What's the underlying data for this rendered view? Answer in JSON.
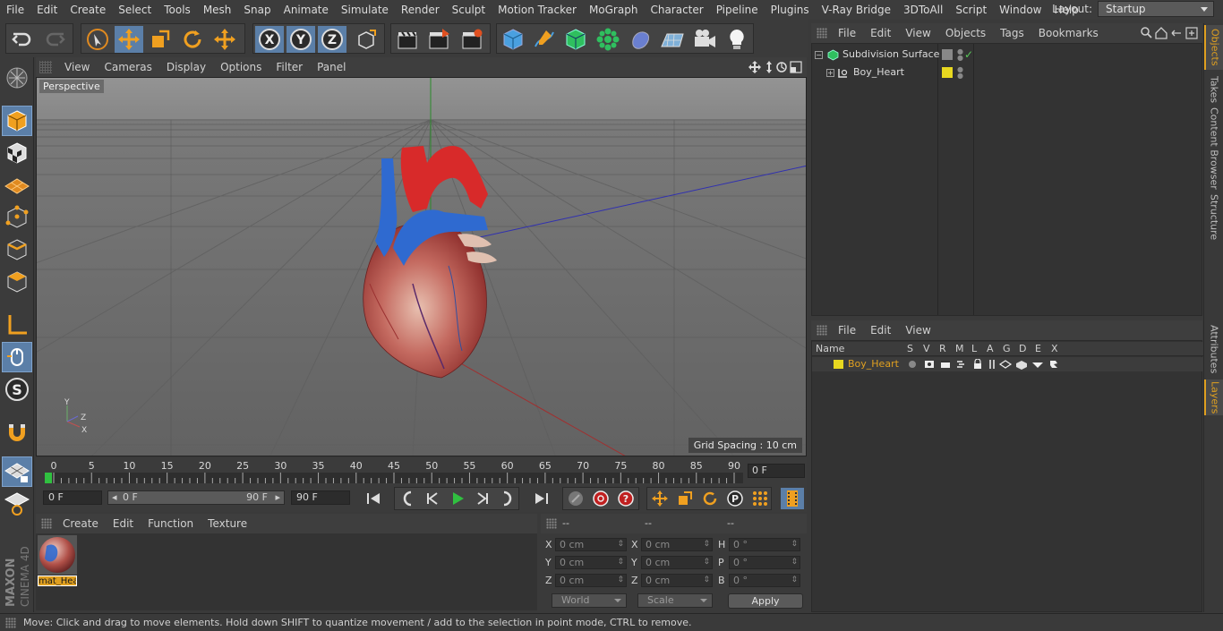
{
  "menu": {
    "items": [
      "File",
      "Edit",
      "Create",
      "Select",
      "Tools",
      "Mesh",
      "Snap",
      "Animate",
      "Simulate",
      "Render",
      "Sculpt",
      "Motion Tracker",
      "MoGraph",
      "Character",
      "Pipeline",
      "Plugins",
      "V-Ray Bridge",
      "3DToAll",
      "Script",
      "Window",
      "Help"
    ],
    "layout_label": "Layout:",
    "layout_value": "Startup"
  },
  "viewport": {
    "menu": [
      "View",
      "Cameras",
      "Display",
      "Options",
      "Filter",
      "Panel"
    ],
    "label": "Perspective",
    "grid_spacing": "Grid Spacing : 10 cm",
    "axis_x": "X",
    "axis_y": "Y",
    "axis_z": "Z"
  },
  "timeline": {
    "ticks": [
      "0",
      "5",
      "10",
      "15",
      "20",
      "25",
      "30",
      "35",
      "40",
      "45",
      "50",
      "55",
      "60",
      "65",
      "70",
      "75",
      "80",
      "85",
      "90"
    ],
    "current_frame": "0 F"
  },
  "transport": {
    "start_field": "0 F",
    "range_start": "0 F",
    "range_end": "90 F",
    "end_field": "90 F"
  },
  "material_manager": {
    "menu": [
      "Create",
      "Edit",
      "Function",
      "Texture"
    ],
    "material_name": "mat_Heart"
  },
  "coordinates": {
    "headers": [
      "--",
      "--",
      "--"
    ],
    "rows": [
      {
        "l1": "X",
        "v1": "0 cm",
        "l2": "X",
        "v2": "0 cm",
        "l3": "H",
        "v3": "0 °"
      },
      {
        "l1": "Y",
        "v1": "0 cm",
        "l2": "Y",
        "v2": "0 cm",
        "l3": "P",
        "v3": "0 °"
      },
      {
        "l1": "Z",
        "v1": "0 cm",
        "l2": "Z",
        "v2": "0 cm",
        "l3": "B",
        "v3": "0 °"
      }
    ],
    "mode_world": "World",
    "mode_scale": "Scale",
    "apply_label": "Apply"
  },
  "status": "Move: Click and drag to move elements. Hold down SHIFT to quantize movement / add to the selection in point mode, CTRL to remove.",
  "object_manager": {
    "menu": [
      "File",
      "Edit",
      "View",
      "Objects",
      "Tags",
      "Bookmarks"
    ],
    "objects": [
      {
        "name": "Subdivision Surface"
      },
      {
        "name": "Boy_Heart"
      }
    ]
  },
  "layer_manager": {
    "menu": [
      "File",
      "Edit",
      "View"
    ],
    "columns": [
      "Name",
      "S",
      "V",
      "R",
      "M",
      "L",
      "A",
      "G",
      "D",
      "E",
      "X"
    ],
    "layer_name": "Boy_Heart",
    "layer_color": "#e8d820"
  },
  "right_tabs": [
    "Objects",
    "Takes",
    "Content Browser",
    "Structure",
    "Attributes",
    "Layers"
  ],
  "colors": {
    "accent": "#5b7fa8",
    "highlight": "#e0a020"
  }
}
